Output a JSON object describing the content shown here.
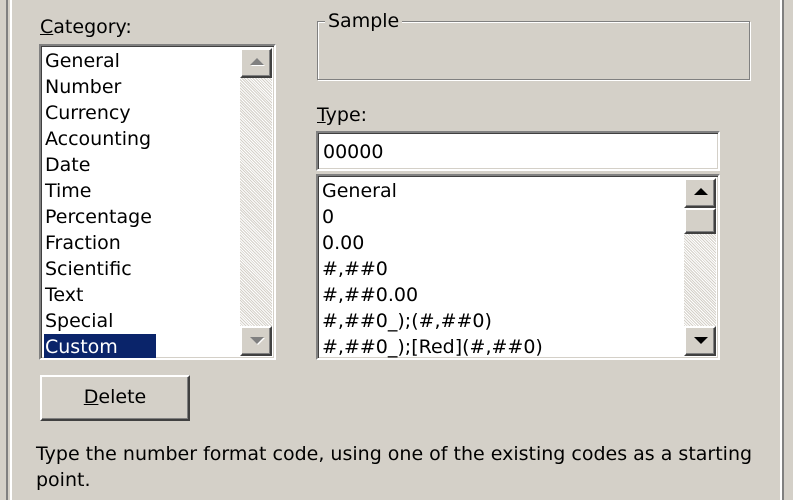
{
  "category": {
    "label_mnemonic": "C",
    "label_rest": "ategory:",
    "items": [
      {
        "label": "General",
        "selected": false
      },
      {
        "label": "Number",
        "selected": false
      },
      {
        "label": "Currency",
        "selected": false
      },
      {
        "label": "Accounting",
        "selected": false
      },
      {
        "label": "Date",
        "selected": false
      },
      {
        "label": "Time",
        "selected": false
      },
      {
        "label": "Percentage",
        "selected": false
      },
      {
        "label": "Fraction",
        "selected": false
      },
      {
        "label": "Scientific",
        "selected": false
      },
      {
        "label": "Text",
        "selected": false
      },
      {
        "label": "Special",
        "selected": false
      },
      {
        "label": "Custom",
        "selected": true
      }
    ]
  },
  "sample": {
    "label": "Sample",
    "value": ""
  },
  "type": {
    "label_mnemonic": "T",
    "label_rest": "ype:",
    "value": "00000",
    "items": [
      "General",
      "0",
      "0.00",
      "#,##0",
      "#,##0.00",
      "#,##0_);(#,##0)",
      "#,##0_);[Red](#,##0)"
    ]
  },
  "delete_button": {
    "mnemonic": "D",
    "rest": "elete"
  },
  "help_text": "Type the number format code, using one of the existing codes as a starting point.",
  "colors": {
    "face": "#d4d0c8",
    "selection": "#0a246a",
    "selection_text": "#ffffff"
  },
  "icons": {
    "scroll_up": "scroll-up-arrow-icon",
    "scroll_down": "scroll-down-arrow-icon"
  }
}
